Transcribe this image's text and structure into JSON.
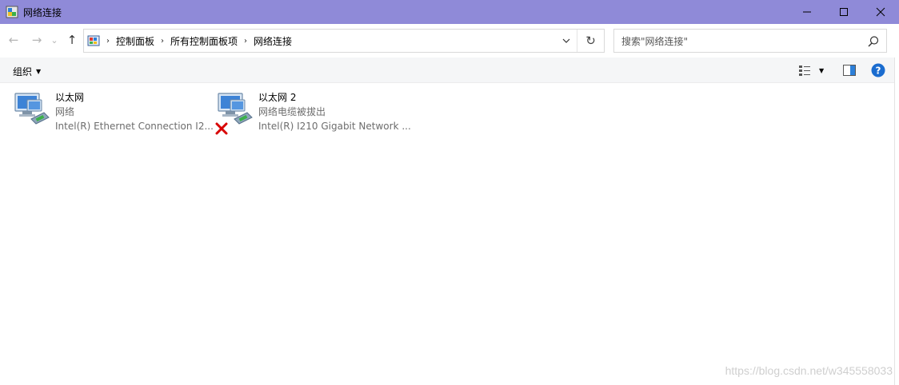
{
  "window": {
    "title": "网络连接",
    "title_icon": "network-folder-icon",
    "controls": [
      "minimize-icon",
      "maximize-icon",
      "close-icon"
    ]
  },
  "nav": {
    "back": "←",
    "forward": "→",
    "recent": "⌄",
    "up": "↑"
  },
  "address": {
    "icon": "control-panel-icon",
    "crumbs": [
      "控制面板",
      "所有控制面板项",
      "网络连接"
    ],
    "dropdown": "chevron-down-icon",
    "refresh": "↻"
  },
  "search": {
    "placeholder": "搜索\"网络连接\""
  },
  "toolbar": {
    "organize": "组织",
    "view_icon": "view-options-icon",
    "preview_icon": "preview-pane-icon",
    "help_icon": "help-icon"
  },
  "items": [
    {
      "name": "以太网",
      "status": "网络",
      "device": "Intel(R) Ethernet Connection I2...",
      "disconnected": false
    },
    {
      "name": "以太网 2",
      "status": "网络电缆被拔出",
      "device": "Intel(R) I210 Gigabit Network ...",
      "disconnected": true
    }
  ],
  "watermark": "https://blog.csdn.net/w345558033",
  "colors": {
    "titlebar": "#8f8ad8",
    "commandbar": "#f5f6f7",
    "help": "#1a6ccf",
    "error": "#d80000"
  }
}
